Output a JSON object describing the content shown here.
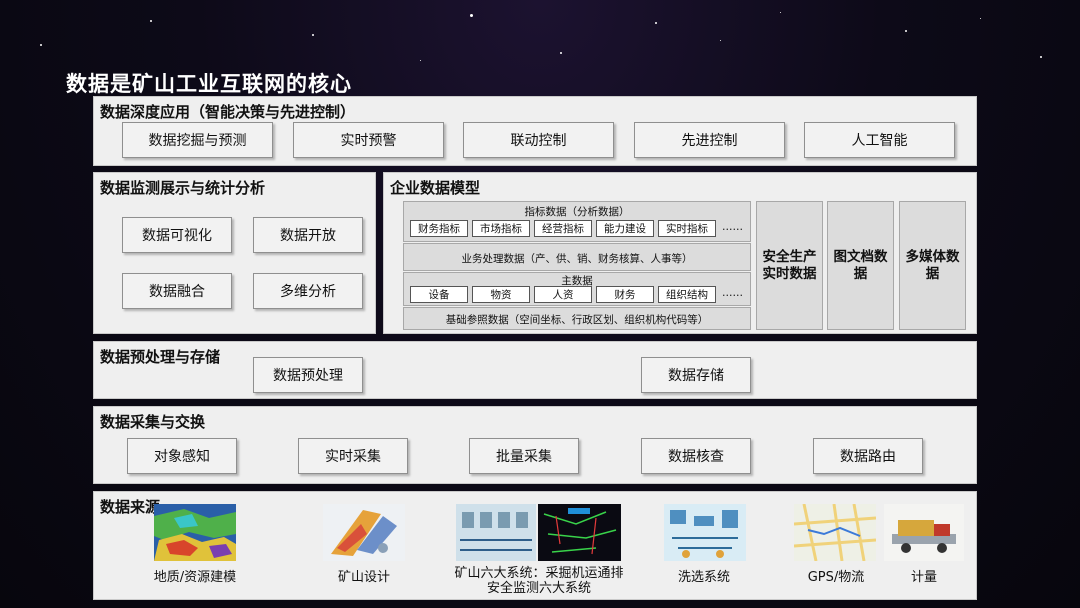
{
  "title": "数据是矿山工业互联网的核心",
  "deep_app": {
    "title": "数据深度应用（智能决策与先进控制）",
    "items": [
      "数据挖掘与预测",
      "实时预警",
      "联动控制",
      "先进控制",
      "人工智能"
    ]
  },
  "monitor": {
    "title": "数据监测展示与统计分析",
    "items": [
      "数据可视化",
      "数据开放",
      "数据融合",
      "多维分析"
    ]
  },
  "model": {
    "title": "企业数据模型",
    "indicator": {
      "label": "指标数据（分析数据）",
      "items": [
        "财务指标",
        "市场指标",
        "经营指标",
        "能力建设",
        "实时指标"
      ],
      "more": "……"
    },
    "business": "业务处理数据（产、供、销、财务核算、人事等）",
    "master": {
      "label": "主数据",
      "items": [
        "设备",
        "物资",
        "人资",
        "财务",
        "组织结构"
      ],
      "more": "……"
    },
    "base": "基础参照数据（空间坐标、行政区划、组织机构代码等）",
    "side": [
      "安全生产实时数据",
      "图文档数据",
      "多媒体数据"
    ]
  },
  "preprocess": {
    "title": "数据预处理与存储",
    "items": [
      "数据预处理",
      "数据存储"
    ]
  },
  "collect": {
    "title": "数据采集与交换",
    "items": [
      "对象感知",
      "实时采集",
      "批量采集",
      "数据核查",
      "数据路由"
    ]
  },
  "source": {
    "title": "数据来源",
    "items": [
      {
        "label": "地质/资源建模",
        "icon": "geology-model-image"
      },
      {
        "label": "矿山设计",
        "icon": "mine-design-image"
      },
      {
        "label": "矿山六大系统：采掘机运通排\n安全监测六大系统",
        "icon": "six-systems-screen-image"
      },
      {
        "label": "洗选系统",
        "icon": "washing-system-image"
      },
      {
        "label": "GPS/物流",
        "icon": "gps-map-image"
      },
      {
        "label": "计量",
        "icon": "weighing-image"
      }
    ]
  },
  "colors": {
    "panel_bg": "#efefef",
    "inner_bg": "#dcdcdc",
    "page_bg": "#0d0a18"
  }
}
